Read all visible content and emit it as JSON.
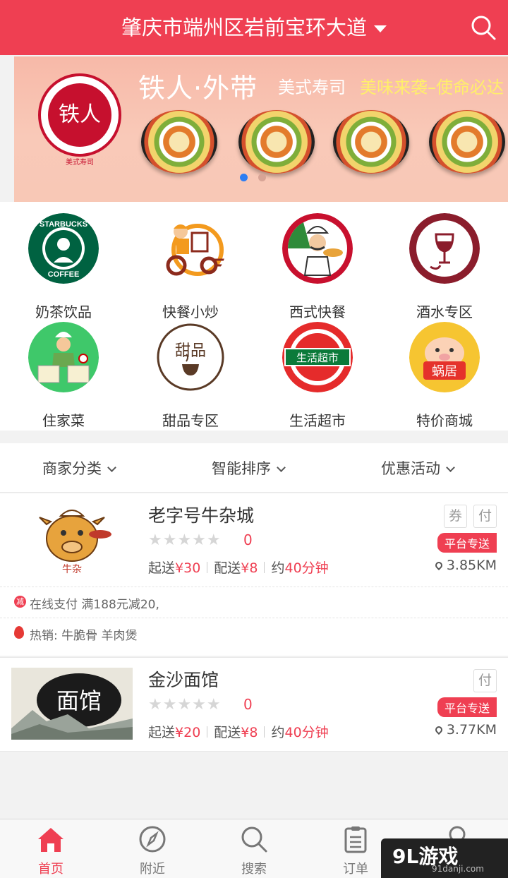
{
  "header": {
    "address": "肇庆市端州区岩前宝环大道",
    "search_icon": "search-icon"
  },
  "banner": {
    "logo_text": "铁人",
    "logo_sub": "美式寿司",
    "title": "铁人·外带",
    "tag1": "美式寿司",
    "tag2": "美味来袭–使命必达",
    "active_slide": 1,
    "slide_count": 2
  },
  "categories": [
    {
      "label": "奶茶饮品",
      "icon": "starbucks-logo-icon"
    },
    {
      "label": "快餐小炒",
      "icon": "delivery-scooter-icon"
    },
    {
      "label": "西式快餐",
      "icon": "chef-pizza-icon"
    },
    {
      "label": "酒水专区",
      "icon": "wine-glass-icon"
    },
    {
      "label": "住家菜",
      "icon": "home-cook-icon"
    },
    {
      "label": "甜品专区",
      "icon": "dessert-cup-icon"
    },
    {
      "label": "生活超市",
      "icon": "supermarket-icon"
    },
    {
      "label": "特价商城",
      "icon": "pig-mall-icon"
    }
  ],
  "category_icon_texts": {
    "starbucks_top": "STARBUCKS",
    "starbucks_bottom": "COFFEE",
    "dessert": "甜品",
    "supermarket": "生活超市",
    "pig_mall": "蜗居"
  },
  "filters": [
    "商家分类",
    "智能排序",
    "优惠活动"
  ],
  "shops": [
    {
      "name": "老字号牛杂城",
      "stars": "★★★★★",
      "rating": "0",
      "min_label": "起送",
      "min_price": "¥30",
      "fee_label": "配送",
      "fee": "¥8",
      "time_label": "约",
      "time": "40分钟",
      "badges": [
        "券",
        "付"
      ],
      "platform": "平台专送",
      "distance": "3.85KM",
      "image_text": "牛杂",
      "promo_icon": "减",
      "promo": "在线支付 满188元减20,",
      "hot": "热销: 牛脆骨 羊肉煲"
    },
    {
      "name": "金沙面馆",
      "stars": "★★★★★",
      "rating": "0",
      "min_label": "起送",
      "min_price": "¥20",
      "fee_label": "配送",
      "fee": "¥8",
      "time_label": "约",
      "time": "40分钟",
      "badges": [
        "付"
      ],
      "platform": "平台专送",
      "distance": "3.77KM",
      "image_text": "面馆"
    }
  ],
  "tabs": [
    {
      "label": "首页",
      "icon": "home-icon",
      "active": true
    },
    {
      "label": "附近",
      "icon": "compass-icon",
      "active": false
    },
    {
      "label": "搜索",
      "icon": "search-icon",
      "active": false
    },
    {
      "label": "订单",
      "icon": "order-list-icon",
      "active": false
    },
    {
      "label": "",
      "icon": "profile-icon",
      "active": false
    }
  ],
  "watermark": {
    "brand": "9L游戏",
    "site": "91danji.com"
  },
  "colors": {
    "accent": "#ef3f52",
    "star_empty": "#d6d6d6",
    "banner_bg": "#f7b9a8"
  }
}
